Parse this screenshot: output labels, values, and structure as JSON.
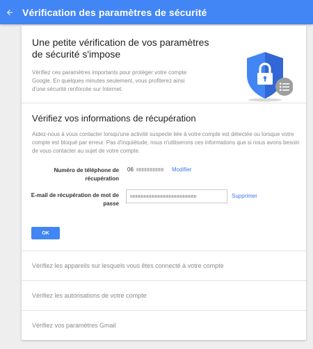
{
  "appbar": {
    "title": "Vérification des paramètres de sécurité",
    "back_icon": "arrow-back-icon",
    "color": "#4285f4"
  },
  "intro": {
    "title": "Une petite vérification de vos paramètres de sécurité s'impose",
    "text": "Vérifiez ces paramètres importants pour protéger votre compte Google. En quelques minutes seulement, vous profiterez ainsi d'une sécurité renforcée sur Internet.",
    "illustration": "shield-lock-icon",
    "shield_color": "#4285f4"
  },
  "recovery": {
    "title": "Vérifiez vos informations de récupération",
    "text": "Aidez-nous à vous contacter lorsqu'une activité suspecte liée à votre compte est détectée ou lorsque votre compte est bloqué par erreur. Pas d'inquiétude, nous n'utiliserons ces informations que si nous avons besoin de vous contacter au sujet de votre compte.",
    "phone_label": "Numéro de téléphone de récupération",
    "phone_value": "06",
    "modify_link": "Modifier",
    "email_label": "E-mail de récupération de mot de passe",
    "delete_link": "Supprimer",
    "ok_button": "OK"
  },
  "checks": [
    "Vérifiez les appareils sur lesquels vous êtes connecté à votre compte",
    "Vérifiez les autorisations de votre compte",
    "Vérifiez vos paramètres Gmail"
  ]
}
